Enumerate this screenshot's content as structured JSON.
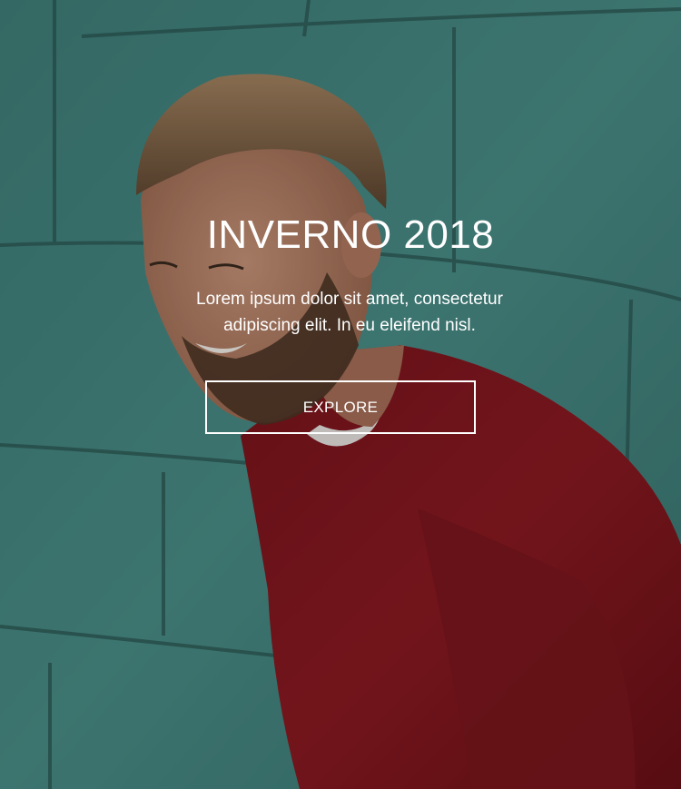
{
  "hero": {
    "title": "INVERNO 2018",
    "subtitle_line1": "Lorem ipsum dolor sit amet, consectetur",
    "subtitle_line2": "adipiscing elit. In eu eleifend nisl.",
    "button_label": "EXPLORE",
    "photo_description_name": "hero-background-photo"
  },
  "colors": {
    "wall_teal": "#4f9590",
    "sweater_red": "#8e1a22",
    "text": "#ffffff"
  }
}
